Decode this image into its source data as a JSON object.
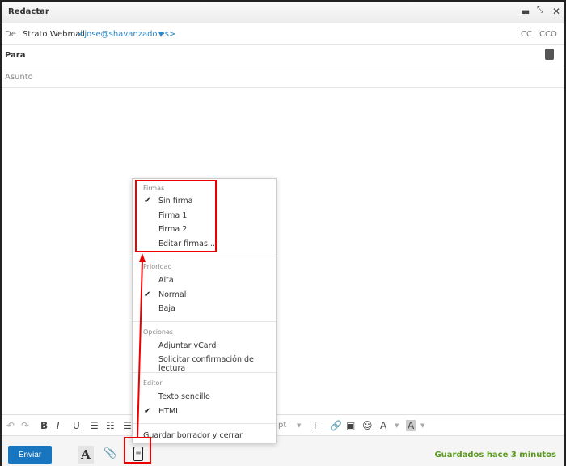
{
  "window": {
    "title": "Redactar",
    "minimize_icon": "minimize-icon",
    "restore_icon": "restore-icon",
    "close_icon": "close-icon"
  },
  "from": {
    "label": "De",
    "name": "Strato Webmail",
    "email": "<jose@shavanzado.es>",
    "cc": "CC",
    "cco": "CCO"
  },
  "to": {
    "label": "Para",
    "contacts_icon": "address-book-icon"
  },
  "subject": {
    "placeholder": "Asunto"
  },
  "toolbar": {
    "size": "pt"
  },
  "menu": {
    "firmas": {
      "header": "Firmas",
      "items": [
        "Sin firma",
        "Firma 1",
        "Firma 2",
        "Editar firmas..."
      ],
      "checked": "Sin firma"
    },
    "prioridad": {
      "header": "Prioridad",
      "items": [
        "Alta",
        "Normal",
        "Baja"
      ],
      "checked": "Normal"
    },
    "opciones": {
      "header": "Opciones",
      "items": [
        "Adjuntar vCard",
        "Solicitar confirmación de lectura"
      ]
    },
    "editor": {
      "header": "Editor",
      "items": [
        "Texto sencillo",
        "HTML"
      ],
      "checked": "HTML"
    },
    "save_close": "Guardar borrador y cerrar"
  },
  "footer": {
    "send": "Enviar",
    "status": "Guardados hace 3 minutos"
  },
  "colors": {
    "accent": "#1776bf",
    "saved": "#5a9a1e",
    "highlight": "#e00000"
  }
}
